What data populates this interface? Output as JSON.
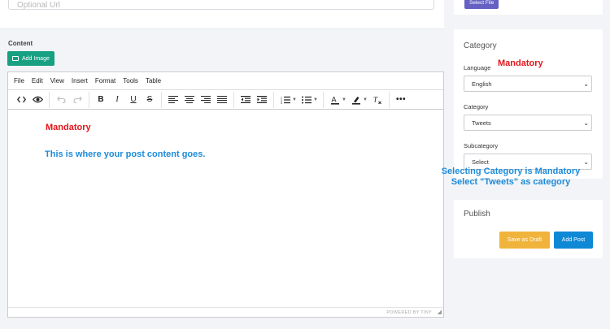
{
  "url_field": {
    "placeholder": "Optional Url"
  },
  "content": {
    "label": "Content",
    "add_image_label": "Add Image"
  },
  "editor": {
    "menu": [
      "File",
      "Edit",
      "View",
      "Insert",
      "Format",
      "Tools",
      "Table"
    ],
    "footer": "POWERED BY TINY",
    "annotation_mandatory": "Mandatory",
    "annotation_content": "This is where your post content goes."
  },
  "sidebar": {
    "select_file_label": "Select File",
    "category_card": {
      "title": "Category",
      "language_label": "Language",
      "language_value": "English",
      "category_label": "Category",
      "category_value": "Tweets",
      "subcategory_label": "Subcategory",
      "subcategory_value": "Select",
      "annotation_mandatory": "Mandatory",
      "annotation_line1": "Selecting Category is Mandatory",
      "annotation_line2": "Select \"Tweets\" as category"
    },
    "publish_card": {
      "title": "Publish",
      "save_draft_label": "Save as Draft",
      "add_post_label": "Add Post"
    }
  },
  "colors": {
    "add_image_green": "#17a082",
    "select_file_purple": "#6461c2",
    "draft_orange": "#f0b43c",
    "add_post_blue": "#0f88d5",
    "annotation_red": "#e4161b",
    "annotation_blue": "#1d8bd9"
  }
}
